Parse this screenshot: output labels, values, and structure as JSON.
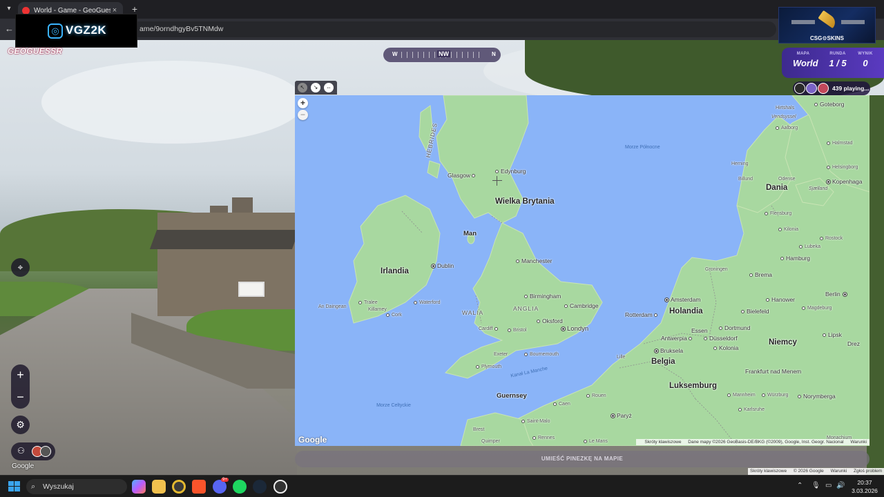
{
  "browser": {
    "tab_title": "World - Game - GeoGuessr",
    "url": "ame/9orndhgyBv5TNMdw",
    "close_tab": "×",
    "new_tab": "+"
  },
  "overlay_logo": {
    "text": "VGZ2K"
  },
  "ad_banner": {
    "label": "CSG⚙SKINS"
  },
  "geoguessr": {
    "logo": "GEOGUESSR",
    "compass": {
      "west": "W",
      "heading": "NW",
      "north": "N"
    },
    "stats": [
      {
        "label": "MAPA",
        "value": "World"
      },
      {
        "label": "RUNDA",
        "value": "1 / 5"
      },
      {
        "label": "WYNIK",
        "value": "0"
      }
    ],
    "playing": "439 playing...",
    "zoom_in": "+",
    "zoom_out": "−",
    "streetview_google": "Google",
    "guess_button": "UMIEŚĆ PINEZKĘ NA MAPIE",
    "bottom_attribution": [
      "Skróty klawiszowe",
      "© 2026 Google",
      "Warunki",
      "Zgłoś problem"
    ]
  },
  "map": {
    "zoom_in": "+",
    "zoom_out": "−",
    "google_logo": "Google",
    "attribution": [
      "Skróty klawiszowe",
      "Dane mapy ©2026 GeoBasis-DE/BKG (©2009), Google, Inst. Geogr. Nacional",
      "Warunki"
    ],
    "countries": {
      "uk": "Wielka Brytania",
      "ireland": "Irlandia",
      "denmark": "Dania",
      "netherlands": "Holandia",
      "belgium": "Belgia",
      "germany": "Niemcy",
      "luxembourg": "Luksemburg"
    },
    "seas": {
      "north": "Morze Północne",
      "celtic": "Morze Celtyckie",
      "channel": "Kanał La Manche"
    },
    "regions": {
      "hebrides": "HEBRIDES",
      "anglia": "ANGLIA",
      "walia": "WALIA"
    },
    "cities": {
      "edinburgh": "Edynburg",
      "glasgow": "Glasgow",
      "man": "Man",
      "manchester": "Manchester",
      "birmingham": "Birmingham",
      "cambridge": "Cambridge",
      "london": "Londyn",
      "oxford": "Oksford",
      "cardiff": "Cardiff",
      "bristol": "Bristol",
      "exeter": "Exeter",
      "bournemouth": "Bournemouth",
      "plymouth": "Plymouth",
      "dublin": "Dublin",
      "waterford": "Waterford",
      "tralee": "Tralee",
      "killarney": "Killarney",
      "cork": "Cork",
      "an_daingean": "An Daingean",
      "guernsey": "Guernsey",
      "caen": "Caen",
      "rouen": "Rouen",
      "paris": "Paryż",
      "saint_malo": "Saint-Malo",
      "brest": "Brest",
      "quimper": "Quimper",
      "rennes": "Rennes",
      "le_mans": "Le Mans",
      "lille": "Lille",
      "amsterdam": "Amsterdam",
      "rotterdam": "Rotterdam",
      "antwerp": "Antwerpia",
      "brussels": "Bruksela",
      "essen": "Essen",
      "dusseldorf": "Düsseldorf",
      "cologne": "Kolonia",
      "dortmund": "Dortmund",
      "bremen": "Brema",
      "hamburg": "Hamburg",
      "hanover": "Hanower",
      "bielefeld": "Bielefeld",
      "berlin": "Berlin",
      "magdeburg": "Magdeburg",
      "lipsk": "Lipsk",
      "drezno": "Drez",
      "frankfurt": "Frankfurt nad Menem",
      "nuremberg": "Norymberga",
      "wurzburg": "Würzburg",
      "karlsruhe": "Karlsruhe",
      "mannheim": "Mannheim",
      "munich": "Monachium",
      "rostock": "Rostock",
      "lubeck": "Lubeka",
      "kiel": "Kilonia",
      "flensburg": "Flensburg",
      "copenhagen": "Kopenhaga",
      "gothenburg": "Goteborg",
      "halmstad": "Halmstad",
      "helsingborg": "Helsingborg",
      "aalborg": "Aalborg",
      "hirtshals": "Hirtshals",
      "vendsyssel": "Vendsyssel",
      "herning": "Herning",
      "billund": "Billund",
      "odense": "Odense",
      "sjaelland": "Sjælland",
      "groningen": "Groningen"
    }
  },
  "taskbar": {
    "search_placeholder": "Wyszukaj",
    "time": "20:37",
    "date": "3.03.2026",
    "discord_badge": "9+"
  }
}
